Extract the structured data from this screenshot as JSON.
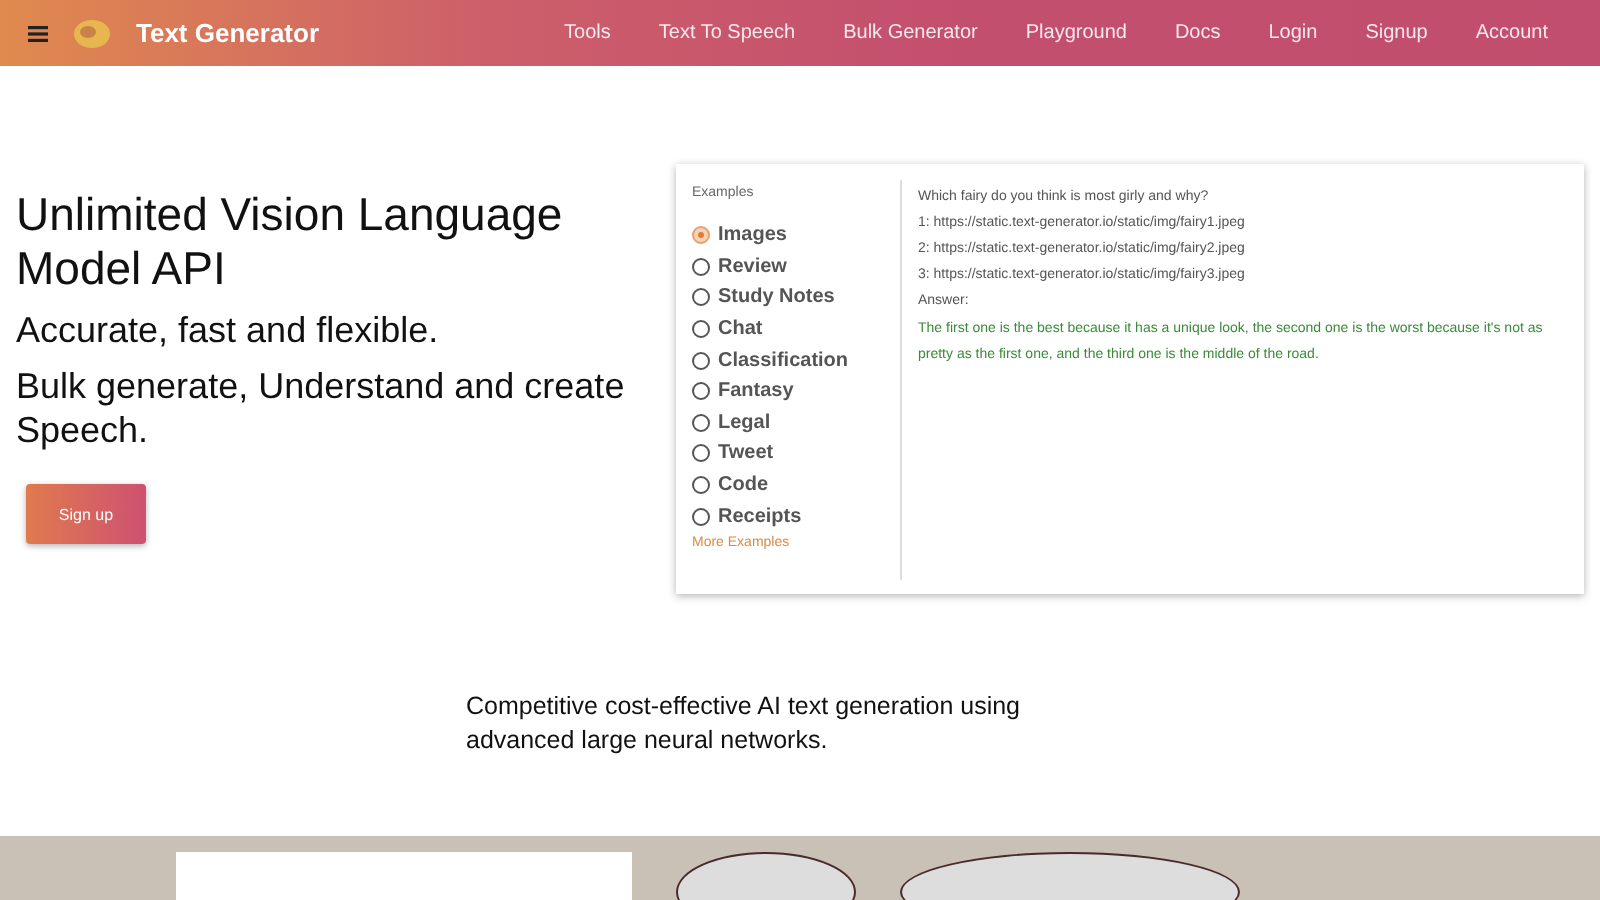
{
  "header": {
    "brand": "Text Generator",
    "nav": [
      "Tools",
      "Text To Speech",
      "Bulk Generator",
      "Playground",
      "Docs",
      "Login",
      "Signup",
      "Account"
    ]
  },
  "hero": {
    "title": "Unlimited Vision Language Model API",
    "subtitle": "Accurate, fast and flexible.",
    "description": "Bulk generate, Understand and create Speech.",
    "button": "Sign up"
  },
  "examples": {
    "heading": "Examples",
    "options": [
      {
        "label": "Images",
        "selected": true
      },
      {
        "label": "Review",
        "selected": false
      },
      {
        "label": "Study Notes",
        "selected": false
      },
      {
        "label": "Chat",
        "selected": false
      },
      {
        "label": "Classification",
        "selected": false
      },
      {
        "label": "Fantasy",
        "selected": false
      },
      {
        "label": "Legal",
        "selected": false
      },
      {
        "label": "Tweet",
        "selected": false
      },
      {
        "label": "Code",
        "selected": false
      },
      {
        "label": "Receipts",
        "selected": false
      }
    ],
    "more_link": "More Examples",
    "prompt_lines": [
      "Which fairy do you think is most girly and why?",
      "1: https://static.text-generator.io/static/img/fairy1.jpeg",
      "2: https://static.text-generator.io/static/img/fairy2.jpeg",
      "3: https://static.text-generator.io/static/img/fairy3.jpeg",
      "Answer:"
    ],
    "answer": "The first one is the best because it has a unique look, the second one is the worst because it's not as pretty as the first one, and the third one is the middle of the road."
  },
  "tagline": "Competitive cost-effective AI text generation using advanced large neural networks."
}
